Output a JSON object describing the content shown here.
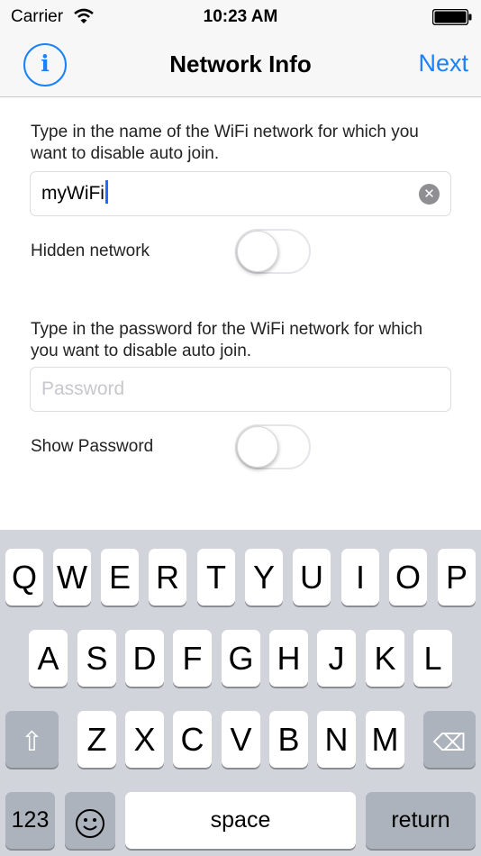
{
  "status_bar": {
    "carrier": "Carrier",
    "time": "10:23 AM",
    "wifi_icon": "wifi-icon",
    "battery_icon": "battery-icon"
  },
  "nav_bar": {
    "title": "Network Info",
    "info_label": "i",
    "next_label": "Next"
  },
  "form": {
    "ssid_instruction": "Type in the name of the WiFi network for which you want to disable auto join.",
    "ssid_value": "myWiFi",
    "ssid_clear_icon": "clear-icon",
    "hidden_label": "Hidden network",
    "hidden_on": false,
    "password_instruction": "Type in the password for the WiFi network for which you want to disable auto join.",
    "password_value": "",
    "password_placeholder": "Password",
    "show_password_label": "Show Password",
    "show_password_on": false
  },
  "keyboard": {
    "row1": [
      "Q",
      "W",
      "E",
      "R",
      "T",
      "Y",
      "U",
      "I",
      "O",
      "P"
    ],
    "row2": [
      "A",
      "S",
      "D",
      "F",
      "G",
      "H",
      "J",
      "K",
      "L"
    ],
    "row3": [
      "Z",
      "X",
      "C",
      "V",
      "B",
      "N",
      "M"
    ],
    "shift_icon": "shift-icon",
    "delete_icon": "delete-icon",
    "numbers_label": "123",
    "emoji_icon": "emoji-icon",
    "space_label": "space",
    "return_label": "return"
  }
}
